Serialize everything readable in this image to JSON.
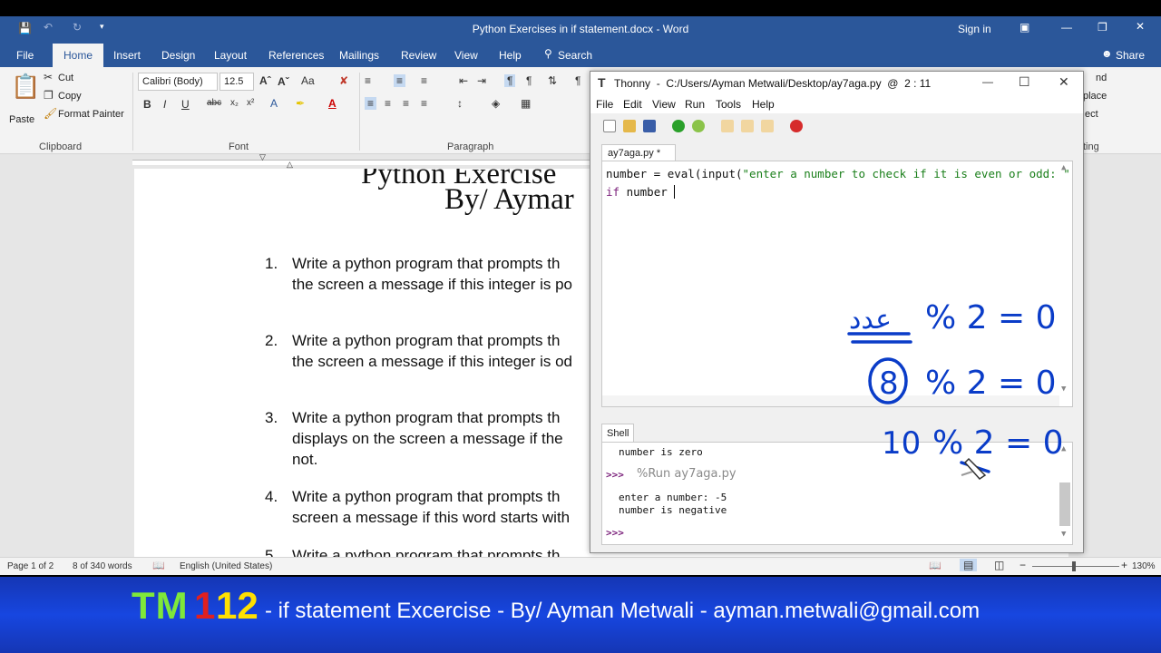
{
  "word": {
    "title": "Python Exercises in if statement.docx - Word",
    "signin": "Sign in",
    "tabs": [
      "File",
      "Home",
      "Insert",
      "Design",
      "Layout",
      "References",
      "Mailings",
      "Review",
      "View",
      "Help"
    ],
    "search": "Search",
    "share": "Share",
    "ribbon": {
      "paste": "Paste",
      "cut": "Cut",
      "copy": "Copy",
      "format_painter": "Format Painter",
      "clipboard": "Clipboard",
      "font_name": "Calibri (Body)",
      "font_size": "12.5",
      "font": "Font",
      "paragraph": "Paragraph",
      "find_partial": "nd",
      "replace_partial": "place",
      "select_partial": "ect",
      "editing_partial": "ting"
    },
    "doc": {
      "title_line1": "Python Exercise",
      "title_line2": "By/ Aymar",
      "items": [
        {
          "num": "1.",
          "line1": "Write a python program that prompts th",
          "line2": "the screen a message if this integer is po"
        },
        {
          "num": "2.",
          "line1": "Write a python program that prompts th",
          "line2": "the screen a message if this integer is od"
        },
        {
          "num": "3.",
          "line1": "Write a python program that prompts th",
          "line2": "displays on the screen a message if the",
          "line3": "not."
        },
        {
          "num": "4.",
          "line1": "Write a python program that prompts th",
          "line2": "screen a message if this word starts with"
        },
        {
          "num": "5.",
          "line1": "Write a python program that prompts th"
        }
      ]
    },
    "status": {
      "page": "Page 1 of 2",
      "words": "8 of 340 words",
      "lang": "English (United States)",
      "zoom": "130%"
    }
  },
  "thonny": {
    "title": "Thonny  -  C:/Users/Ayman Metwali/Desktop/ay7aga.py  @  2 : 11",
    "menu": [
      "File",
      "Edit",
      "View",
      "Run",
      "Tools",
      "Help"
    ],
    "editor_tab": "ay7aga.py *",
    "code_line1_a": "number = eval(input(",
    "code_line1_str": "\"enter a number to check if it is even or odd: \"",
    "code_line1_b": "))",
    "code_line2_kw": "if",
    "code_line2_rest": " number ",
    "shell_tab": "Shell",
    "shell": {
      "line1": "number is zero",
      "prompt": ">>>",
      "run_cmd": "%Run ay7aga.py",
      "line3": "enter a number: -5",
      "line4": "number is negative",
      "prompt2": ">>>"
    }
  },
  "annotations": {
    "arabic": "عدد",
    "row1": "% 2 = 0",
    "row2_circled": "8",
    "row2": "% 2 = 0",
    "row3_num": "10",
    "row3": "% 2 = 0"
  },
  "banner": {
    "tm": "TM",
    "one": "1",
    "twelve": "12",
    "text": "- if statement Excercise - By/ Ayman Metwali - ayman.metwali@gmail.com"
  }
}
